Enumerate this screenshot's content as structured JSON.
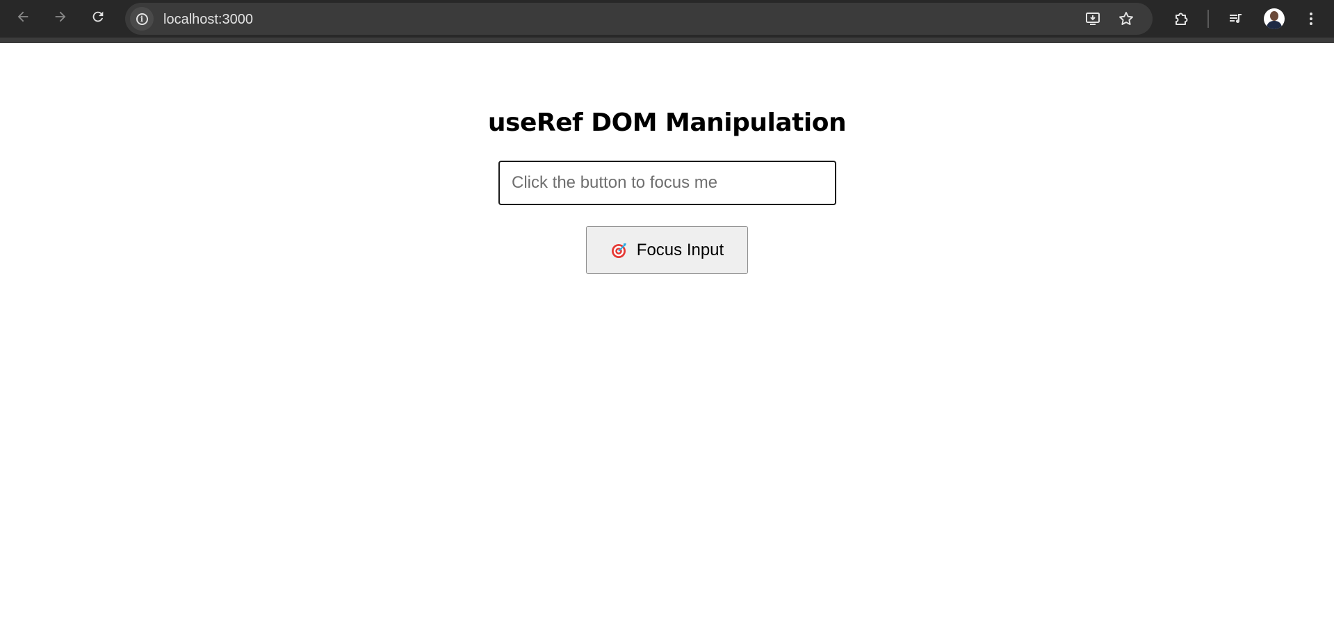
{
  "browser": {
    "url": "localhost:3000",
    "back_icon": "arrow-left-icon",
    "forward_icon": "arrow-right-icon",
    "reload_icon": "reload-icon",
    "site_info_icon": "info-icon",
    "install_icon": "install-app-icon",
    "bookmark_icon": "star-icon",
    "extensions_icon": "puzzle-icon",
    "media_icon": "media-queue-icon",
    "menu_icon": "kebab-menu-icon"
  },
  "page": {
    "title": "useRef DOM Manipulation",
    "input": {
      "value": "",
      "placeholder": "Click the button to focus me"
    },
    "button": {
      "icon": "target-icon",
      "label": "Focus Input"
    }
  },
  "colors": {
    "toolbar_bg": "#282828",
    "omnibox_bg": "#3b3b3b",
    "button_bg": "#efefef",
    "target_red": "#e53935",
    "dart_blue": "#29a8e0"
  }
}
